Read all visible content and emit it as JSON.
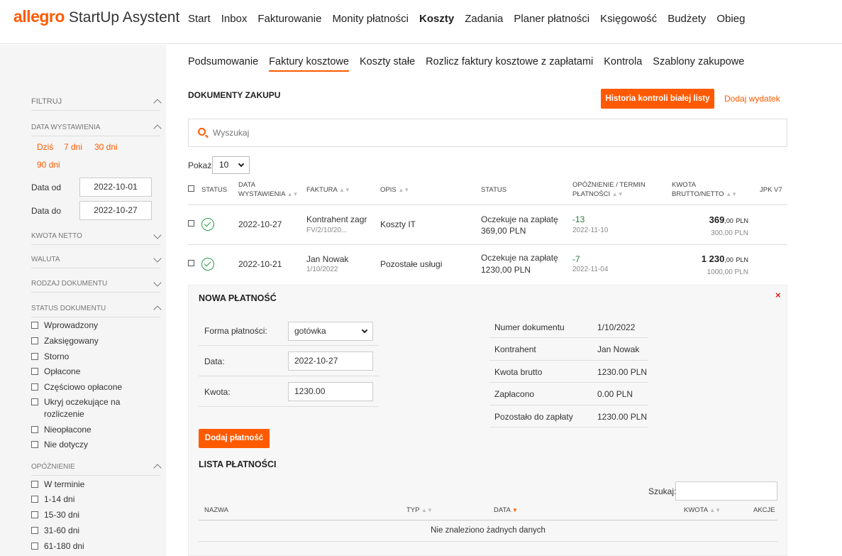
{
  "header": {
    "brand": "allegro",
    "product": "StartUp Asystent",
    "nav": [
      "Start",
      "Inbox",
      "Fakturowanie",
      "Monity płatności",
      "Koszty",
      "Zadania",
      "Planer płatności",
      "Księgowość",
      "Budżety",
      "Obieg"
    ],
    "active_nav": "Koszty"
  },
  "sidebar": {
    "filter_title": "FILTRUJ",
    "date_section": "DATA WYSTAWIENIA",
    "quick": [
      "Dziś",
      "7 dni",
      "30 dni",
      "90 dni"
    ],
    "date_from_label": "Data od",
    "date_from": "2022-10-01",
    "date_to_label": "Data do",
    "date_to": "2022-10-27",
    "kwota_netto": "KWOTA NETTO",
    "waluta": "WALUTA",
    "rodzaj": "RODZAJ DOKUMENTU",
    "status_title": "STATUS DOKUMENTU",
    "statuses": [
      "Wprowadzony",
      "Zaksięgowany",
      "Storno",
      "Opłacone",
      "Częściowo opłacone",
      "Ukryj oczekujące na rozliczenie",
      "Nieopłacone",
      "Nie dotyczy"
    ],
    "delay_title": "OPÓŹNIENIE",
    "delays": [
      "W terminie",
      "1-14 dni",
      "15-30 dni",
      "31-60 dni",
      "61-180 dni"
    ]
  },
  "subnav": [
    "Podsumowanie",
    "Faktury kosztowe",
    "Koszty stałe",
    "Rozlicz faktury kosztowe z zapłatami",
    "Kontrola",
    "Szablony zakupowe"
  ],
  "main": {
    "title": "DOKUMENTY ZAKUPU",
    "history_btn": "Historia kontroli białej listy",
    "add_expense": "Dodaj wydatek",
    "search_placeholder": "Wyszukaj",
    "show_label": "Pokaż",
    "show_value": "10",
    "columns": {
      "status": "STATUS",
      "date_1": "DATA",
      "date_2": "WYSTAWIENIA",
      "invoice": "FAKTURA",
      "desc": "OPIS",
      "status2": "STATUS",
      "delay_1": "OPÓŹNIENIE / TERMIN",
      "delay_2": "PŁATNOŚCI",
      "amount_1": "KWOTA",
      "amount_2": "BRUTTO/NETTO",
      "jpk": "JPK V7"
    },
    "rows": [
      {
        "date": "2022-10-27",
        "contractor": "Kontrahent zagr",
        "number": "FV/2/10/20...",
        "desc": "Koszty IT",
        "status_line1": "Oczekuje na zapłatę",
        "status_line2": "369,00 PLN",
        "delay": "-13",
        "due": "2022-11-10",
        "gross_int": "369",
        "gross_dec": ",00",
        "currency": "PLN",
        "net": "300,00 PLN"
      },
      {
        "date": "2022-10-21",
        "contractor": "Jan Nowak",
        "number": "1/10/2022",
        "desc": "Pozostałe usługi",
        "status_line1": "Oczekuje na zapłatę",
        "status_line2": "1230,00 PLN",
        "delay": "-7",
        "due": "2022-11-04",
        "gross_int": "1 230",
        "gross_dec": ",00",
        "currency": "PLN",
        "net": "1000,00 PLN"
      }
    ]
  },
  "payment": {
    "title": "NOWA PŁATNOŚĆ",
    "close": "×",
    "method_label": "Forma płatności:",
    "method": "gotówka",
    "date_label": "Data:",
    "date": "2022-10-27",
    "amount_label": "Kwota:",
    "amount": "1230.00",
    "add_btn": "Dodaj płatność",
    "info": [
      {
        "label": "Numer dokumentu",
        "value": "1/10/2022"
      },
      {
        "label": "Kontrahent",
        "value": "Jan Nowak"
      },
      {
        "label": "Kwota brutto",
        "value": "1230.00 PLN"
      },
      {
        "label": "Zapłacono",
        "value": "0.00 PLN"
      },
      {
        "label": "Pozostało do zapłaty",
        "value": "1230.00 PLN"
      }
    ],
    "list_title": "LISTA PŁATNOŚCI",
    "search_label": "Szukaj:",
    "cols": {
      "name": "NAZWA",
      "type": "TYP",
      "date": "DATA",
      "amount": "KWOTA",
      "actions": "AKCJE"
    },
    "empty": "Nie znaleziono żadnych danych"
  },
  "colors": {
    "accent": "#ff5a00",
    "ok": "#2a9d4a",
    "close": "#e02020"
  }
}
